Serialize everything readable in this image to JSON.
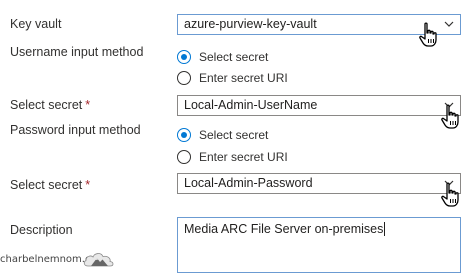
{
  "form": {
    "key_vault": {
      "label": "Key vault",
      "value": "azure-purview-key-vault"
    },
    "username_method": {
      "label": "Username input method",
      "options": [
        "Select secret",
        "Enter secret URI"
      ],
      "selected": "Select secret"
    },
    "username_secret": {
      "label": "Select secret",
      "required_mark": "*",
      "value": "Local-Admin-UserName"
    },
    "password_method": {
      "label": "Password input method",
      "options": [
        "Select secret",
        "Enter secret URI"
      ],
      "selected": "Select secret"
    },
    "password_secret": {
      "label": "Select secret",
      "required_mark": "*",
      "value": "Local-Admin-Password"
    },
    "description": {
      "label": "Description",
      "value": "Media ARC File Server on-premises"
    }
  },
  "watermark": {
    "text": "charbelnemnom.com"
  },
  "colors": {
    "accent": "#0078d4",
    "border": "#8a8886",
    "focus_border": "#6b9bd2",
    "required": "#a4262c"
  },
  "icons": {
    "dropdown": "chevron-down-icon",
    "pointer": "hand-pointer-icon",
    "watermark": "cloud-mountain-logo"
  }
}
